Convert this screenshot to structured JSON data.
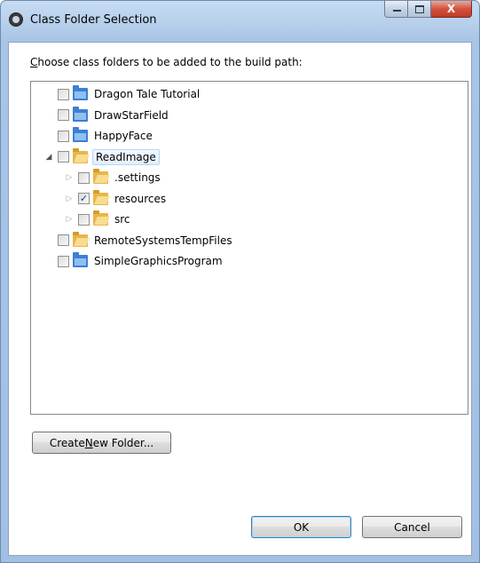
{
  "window": {
    "title": "Class Folder Selection",
    "close_glyph": "X"
  },
  "prompt": {
    "prefix_mnemonic": "C",
    "rest": "hoose class folders to be added to the build path:"
  },
  "tree": {
    "items": [
      {
        "label": "Dragon Tale Tutorial",
        "checked": false,
        "expander": "none",
        "icon": "project-folder-icon",
        "level": 0
      },
      {
        "label": "DrawStarField",
        "checked": false,
        "expander": "none",
        "icon": "project-folder-icon",
        "level": 0
      },
      {
        "label": "HappyFace",
        "checked": false,
        "expander": "none",
        "icon": "project-folder-icon",
        "level": 0
      },
      {
        "label": "ReadImage",
        "checked": false,
        "expander": "expanded",
        "icon": "open-folder-icon",
        "level": 0,
        "selected": true
      },
      {
        "label": ".settings",
        "checked": false,
        "expander": "collapsed",
        "icon": "folder-icon",
        "level": 1
      },
      {
        "label": "resources",
        "checked": true,
        "expander": "collapsed",
        "icon": "folder-icon",
        "level": 1
      },
      {
        "label": "src",
        "checked": false,
        "expander": "collapsed",
        "icon": "folder-icon",
        "level": 1
      },
      {
        "label": "RemoteSystemsTempFiles",
        "checked": false,
        "expander": "none",
        "icon": "open-folder-icon",
        "level": 0
      },
      {
        "label": "SimpleGraphicsProgram",
        "checked": false,
        "expander": "none",
        "icon": "project-folder-icon",
        "level": 0
      }
    ]
  },
  "buttons": {
    "create_prefix": "Create ",
    "create_mnemonic": "N",
    "create_suffix": "ew Folder...",
    "ok": "OK",
    "cancel": "Cancel"
  },
  "glyphs": {
    "expanded": "◢",
    "collapsed": "▷",
    "check": "✓"
  }
}
